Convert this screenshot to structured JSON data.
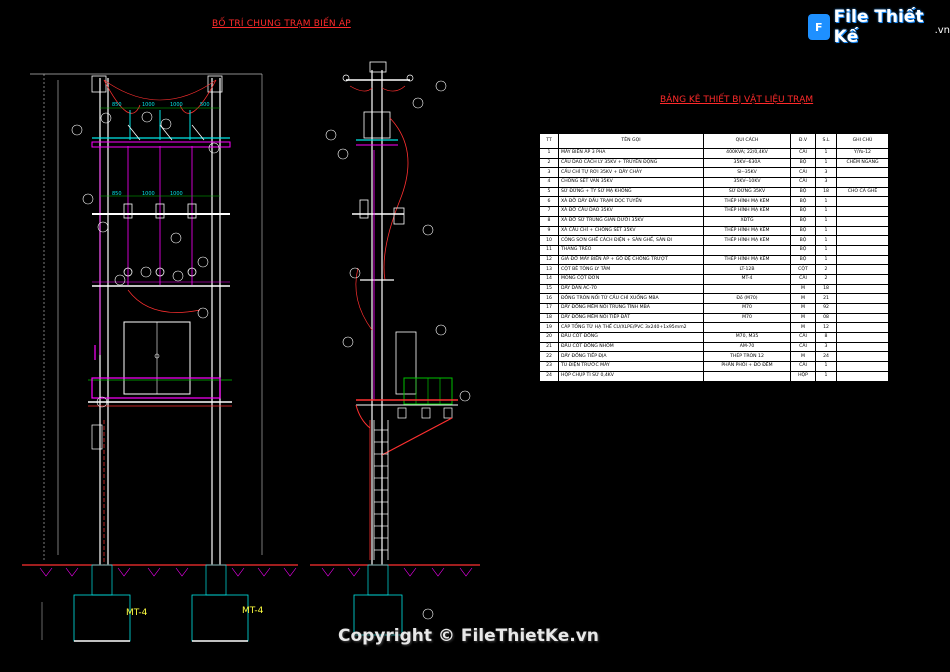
{
  "titles": {
    "left": "BỐ TRÍ CHUNG TRẠM BIẾN ÁP",
    "right": "BẢNG KÊ THIẾT BỊ VẬT LIỆU TRẠM"
  },
  "watermark": {
    "logo_mark": "F",
    "logo_text": "File Thiết Kế",
    "logo_tld": ".vn",
    "copyright": "Copyright © FileThietKe.vn"
  },
  "dimensions": [
    "850",
    "1000",
    "1000",
    "500",
    "850",
    "1000",
    "1000"
  ],
  "foundation_labels": [
    "MT-4",
    "MT-4"
  ],
  "table": {
    "headers": [
      "TT",
      "TÊN GỌI",
      "QUI CÁCH",
      "Đ.V",
      "S.L",
      "GHI CHÚ"
    ],
    "rows": [
      [
        "1",
        "MÁY BIẾN ÁP 3 PHA",
        "400KVA; 22/0,4KV",
        "CÁI",
        "1",
        "Y/Yo-12"
      ],
      [
        "2",
        "CẦU DAO CÁCH LY 35KV + TRUYỀN ĐỘNG",
        "35KV--630A",
        "BỘ",
        "1",
        "CHÉM NGANG"
      ],
      [
        "3",
        "CẦU CHÌ TỰ RƠI 35KV + DÂY CHẢY",
        "SI--35KV",
        "CÁI",
        "3",
        ""
      ],
      [
        "4",
        "CHỐNG SÉT VAN 35KV",
        "35KV--10KV",
        "CÁI",
        "3",
        ""
      ],
      [
        "5",
        "SỨ ĐỨNG + TY SỨ MẠ KHÔNG",
        "SỨ ĐỨNG 35KV",
        "BỘ",
        "18",
        "CHO CẢ GHẾ"
      ],
      [
        "6",
        "XÀ ĐỠ DÂY ĐẦU TRẠM DỌC TUYẾN",
        "THÉP HÌNH MẠ KẼM",
        "BỘ",
        "1",
        ""
      ],
      [
        "7",
        "XÀ ĐỠ CẦU DAO 35KV",
        "THÉP HÌNH MẠ KẼM",
        "BỘ",
        "1",
        ""
      ],
      [
        "8",
        "XÀ ĐỠ SỨ TRUNG GIAN DƯỚI 35KV",
        "XĐTG",
        "BỘ",
        "1",
        ""
      ],
      [
        "9",
        "XÀ CẦU CHÌ + CHỐNG SÉT 35KV",
        "THÉP HÌNH MẠ KẼM",
        "BỘ",
        "1",
        ""
      ],
      [
        "10",
        "CÔNG SƠN GHẾ CÁCH ĐIỆN + SÀN GHẾ, SÀN ĐI",
        "THÉP HÌNH MẠ KẼM",
        "BỘ",
        "1",
        ""
      ],
      [
        "11",
        "THANG TRÈO",
        "",
        "BỘ",
        "1",
        ""
      ],
      [
        "12",
        "GIÁ ĐỠ MÁY BIẾN ÁP + GỖ ĐỆ CHỐNG TRƯỢT",
        "THÉP HÌNH MẠ KẼM",
        "BỘ",
        "1",
        ""
      ],
      [
        "13",
        "CỘT BÊ TÔNG LY TÂM",
        "LT-12B",
        "CỘT",
        "2",
        ""
      ],
      [
        "14",
        "MÓNG CỘT ĐƠN",
        "MT-4",
        "CÁI",
        "2",
        ""
      ],
      [
        "15",
        "DÂY DẪN AC-70",
        "",
        "M",
        "18",
        ""
      ],
      [
        "16",
        "ĐỒNG TRÒN NỐI TỪ CẦU CHÌ XUỐNG MBA",
        "Đồ (M70)",
        "M",
        "21",
        ""
      ],
      [
        "17",
        "DÂY ĐỒNG MỀM NỐI TRUNG TÍNH MBA",
        "M70",
        "M",
        "92",
        ""
      ],
      [
        "18",
        "DÂY ĐỒNG MỀM NỐI TIẾP ĐẤT",
        "M70",
        "M",
        "08",
        ""
      ],
      [
        "19",
        "CÁP TỔNG TỪ HẠ THẾ CU/XLPE/PVC 3x240+1x95mm2",
        "",
        "M",
        "12",
        ""
      ],
      [
        "20",
        "ĐẦU CỐT ĐỒNG",
        "M70, M35",
        "CÁI",
        "8",
        ""
      ],
      [
        "21",
        "ĐẦU CỐT ĐỒNG NHÔM",
        "AM-70",
        "CÁI",
        "3",
        ""
      ],
      [
        "22",
        "DÂY ĐỒNG TIẾP ĐỊA",
        "THÉP TRÒN 12",
        "M",
        "24",
        ""
      ],
      [
        "23",
        "TỦ ĐIỆN TRƯỚC MÁY",
        "PHÂN PHỐI + ĐO ĐẾM",
        "CÁI",
        "1",
        ""
      ],
      [
        "24",
        "HỘP CHỤP TI SỨ 0,4KV",
        "",
        "HỘP",
        "1",
        ""
      ]
    ]
  },
  "colors": {
    "background": "#000000",
    "title": "#ff2a2a",
    "cyan": "#00e5e5",
    "magenta": "#ff00ff",
    "red": "#ff3030",
    "white": "#ffffff",
    "green": "#00c000"
  }
}
